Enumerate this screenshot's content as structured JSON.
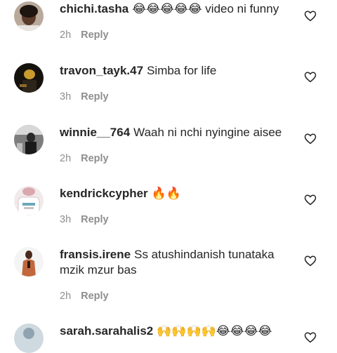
{
  "comments": [
    {
      "username": "chichi.tasha",
      "text": "😂😂😂😂😂 video ni funny",
      "time": "2h",
      "reply_label": "Reply",
      "avatar": "avatar-woman-photo",
      "like_icon": "heart-outline-icon"
    },
    {
      "username": "travon_tayk.47",
      "text": "Simba for life",
      "time": "3h",
      "reply_label": "Reply",
      "avatar": "avatar-dark-photo",
      "like_icon": "heart-outline-icon"
    },
    {
      "username": "winnie__764",
      "text": "Waah ni nchi nyingine aisee",
      "time": "2h",
      "reply_label": "Reply",
      "avatar": "avatar-grayscale-photo",
      "like_icon": "heart-outline-icon"
    },
    {
      "username": "kendrickcypher",
      "text": "🔥🔥",
      "time": "3h",
      "reply_label": "Reply",
      "avatar": "avatar-shirt-photo",
      "like_icon": "heart-outline-icon"
    },
    {
      "username": "fransis.irene",
      "text": "Ss atushindanish tunataka mzik mzur bas",
      "time": "2h",
      "reply_label": "Reply",
      "avatar": "avatar-person-photo",
      "like_icon": "heart-outline-icon"
    },
    {
      "username": "sarah.sarahalis2",
      "text": "🙌🙌🙌🙌😂😂😂😂",
      "time": "",
      "reply_label": "",
      "avatar": "avatar-light-photo",
      "like_icon": "heart-outline-icon"
    }
  ],
  "colors": {
    "text": "#262626",
    "secondary": "#8e8e8e",
    "background": "#ffffff"
  }
}
